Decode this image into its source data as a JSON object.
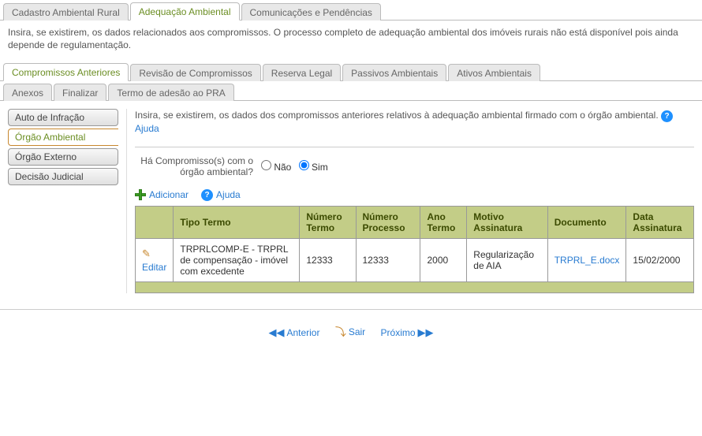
{
  "mainTabs": [
    {
      "label": "Cadastro Ambiental Rural",
      "active": false
    },
    {
      "label": "Adequação Ambiental",
      "active": true
    },
    {
      "label": "Comunicações e Pendências",
      "active": false
    }
  ],
  "infoText": "Insira, se existirem, os dados relacionados aos compromissos. O processo completo de adequação ambiental dos imóveis rurais não está disponível pois ainda depende de regulamentação.",
  "subTabs1": [
    {
      "label": "Compromissos Anteriores",
      "active": true
    },
    {
      "label": "Revisão de Compromissos",
      "active": false
    },
    {
      "label": "Reserva Legal",
      "active": false
    },
    {
      "label": "Passivos Ambientais",
      "active": false
    },
    {
      "label": "Ativos Ambientais",
      "active": false
    }
  ],
  "subTabs2": [
    {
      "label": "Anexos",
      "active": false
    },
    {
      "label": "Finalizar",
      "active": false
    },
    {
      "label": "Termo de adesão ao PRA",
      "active": false
    }
  ],
  "sideButtons": [
    {
      "label": "Auto de Infração",
      "active": false
    },
    {
      "label": "Órgão Ambiental",
      "active": true
    },
    {
      "label": "Órgão Externo",
      "active": false
    },
    {
      "label": "Decisão Judicial",
      "active": false
    }
  ],
  "panelDesc": "Insira, se existirem, os dados dos compromissos anteriores relativos à adequação ambiental firmado com o órgão ambiental.",
  "helpLabel": "Ajuda",
  "question": {
    "label": "Há Compromisso(s) com o órgão ambiental?",
    "optNo": "Não",
    "optYes": "Sim",
    "value": "Sim"
  },
  "addLabel": "Adicionar",
  "table": {
    "headers": {
      "empty": "",
      "tipo": "Tipo Termo",
      "numTermo": "Número Termo",
      "numProc": "Número Processo",
      "ano": "Ano Termo",
      "motivo": "Motivo Assinatura",
      "doc": "Documento",
      "data": "Data Assinatura"
    },
    "rows": [
      {
        "editLabel": "Editar",
        "tipo": "TRPRLCOMP-E - TRPRL de compensação - imóvel com excedente",
        "numTermo": "12333",
        "numProc": "12333",
        "ano": "2000",
        "motivo": "Regularização de AIA",
        "doc": "TRPRL_E.docx",
        "data": "15/02/2000"
      }
    ]
  },
  "nav": {
    "prev": "Anterior",
    "exit": "Sair",
    "next": "Próximo"
  }
}
